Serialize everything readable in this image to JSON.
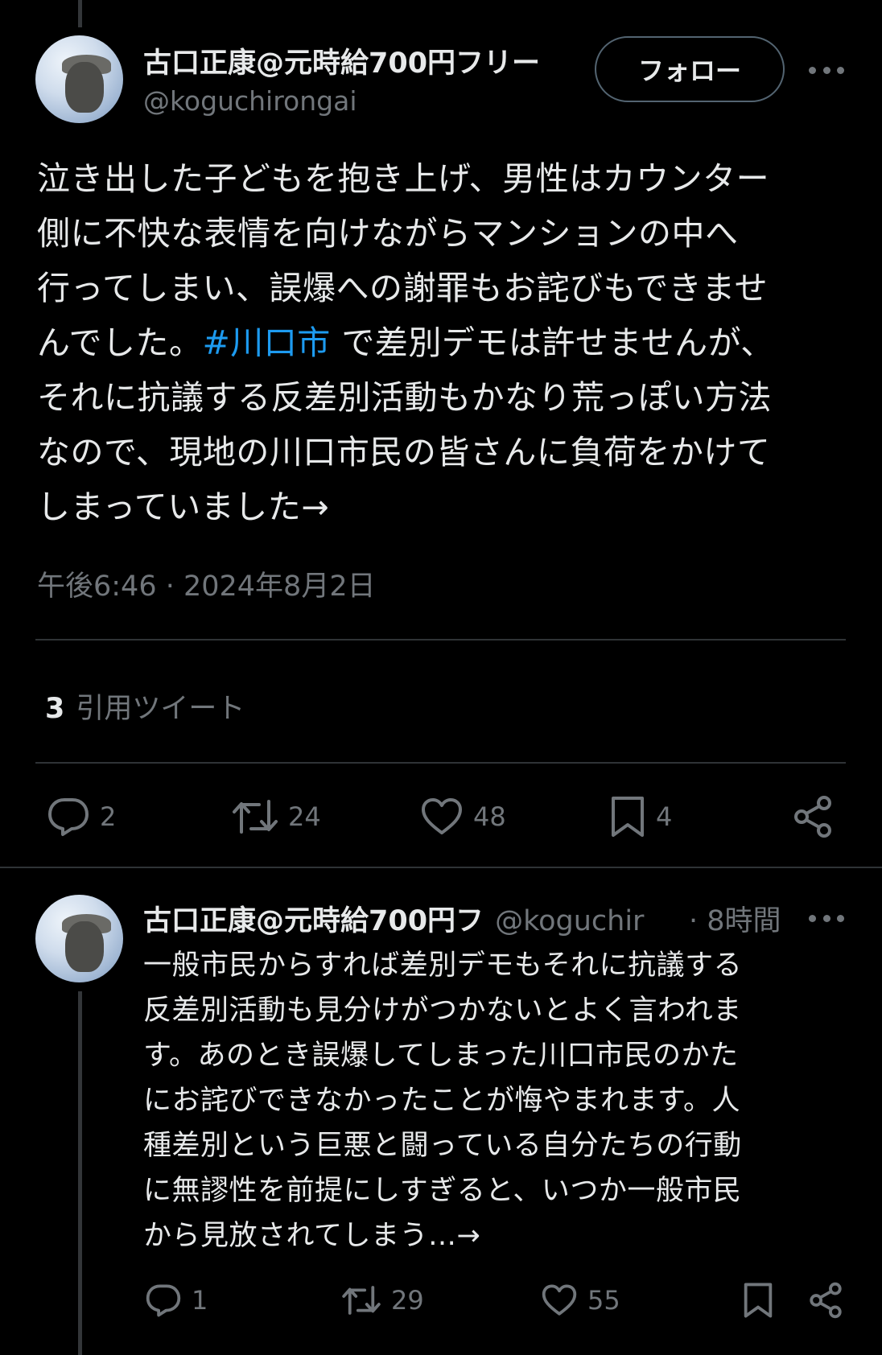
{
  "main_tweet": {
    "author_name": "古口正康@元時給700円フリー",
    "handle": "@koguchirongai",
    "follow_label": "フォロー",
    "text_lines": [
      [
        "泣き出した子どもを抱き上げ、男性はカウンター"
      ],
      [
        "側に不快な表情を向けながらマンションの中へ"
      ],
      [
        "行ってしまい、誤爆への謝罪もお詫びもできませ"
      ],
      [
        "んでした。",
        "#川口市",
        " で差別デモは許せませんが、"
      ],
      [
        "それに抗議する反差別活動もかなり荒っぽい方法"
      ],
      [
        "なので、現地の川口市民の皆さんに負荷をかけて"
      ],
      [
        "しまっていました→"
      ]
    ],
    "timestamp": "午後6:46 · 2024年8月2日",
    "quote_count": "3",
    "quote_label": "引用ツイート",
    "actions": {
      "replies": "2",
      "retweets": "24",
      "likes": "48",
      "bookmarks": "4"
    }
  },
  "reply_tweet": {
    "author_name": "古口正康@元時給700円フ",
    "handle_time": "@koguchir",
    "time": "· 8時間",
    "text_lines": [
      "一般市民からすれば差別デモもそれに抗議する",
      "反差別活動も見分けがつかないとよく言われま",
      "す。あのとき誤爆してしまった川口市民のかた",
      "にお詫びできなかったことが悔やまれます。人",
      "種差別という巨悪と闘っている自分たちの行動",
      "に無謬性を前提にしすぎると、いつか一般市民",
      "から見放されてしまう…→"
    ],
    "actions": {
      "replies": "1",
      "retweets": "29",
      "likes": "55"
    }
  },
  "colors": {
    "background": "#000000",
    "text": "#e7e9ea",
    "secondary": "#71767b",
    "link": "#1d9bf0",
    "divider": "#2f3336"
  },
  "icons": [
    "more-icon",
    "reply-icon",
    "retweet-icon",
    "like-icon",
    "bookmark-icon",
    "share-icon"
  ]
}
